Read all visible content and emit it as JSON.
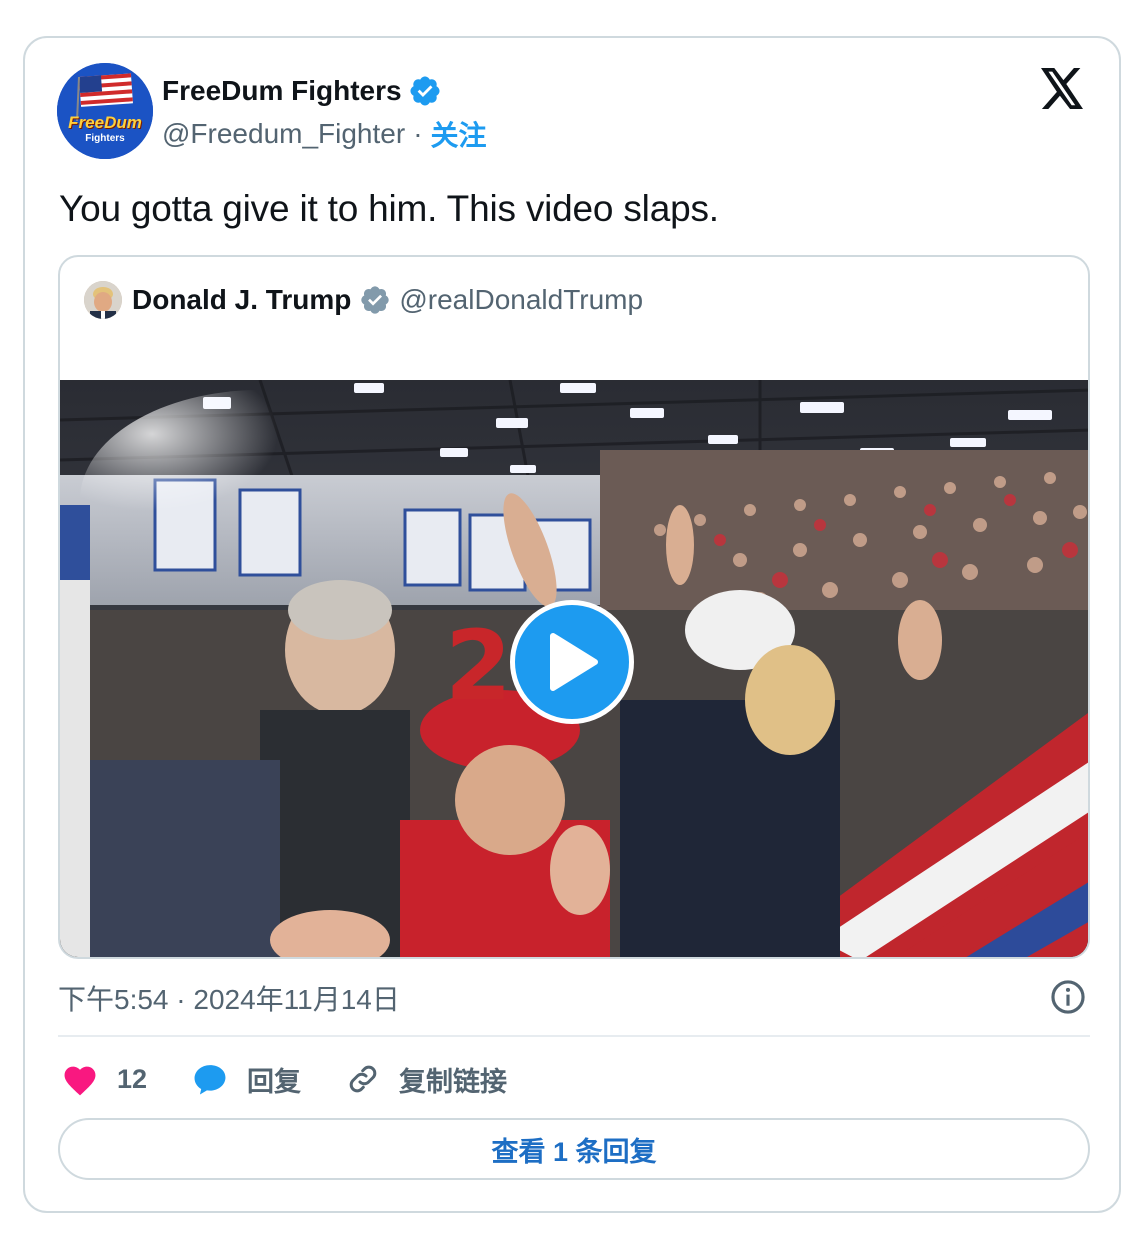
{
  "author": {
    "name": "FreeDum Fighters",
    "handle": "@Freedum_Fighter",
    "separator": "·",
    "follow_label": "关注",
    "avatar_text_1": "FreeDum",
    "avatar_text_2": "Fighters"
  },
  "tweet": {
    "text": "You gotta give it to him. This video slaps."
  },
  "quoted": {
    "name": "Donald J. Trump",
    "handle": "@realDonaldTrump",
    "video_overlay_text": "2  2"
  },
  "meta": {
    "timestamp": "下午5:54 · 2024年11月14日"
  },
  "actions": {
    "like_count": "12",
    "reply_label": "回复",
    "copy_link_label": "复制链接"
  },
  "replies_button": {
    "label": "查看 1 条回复"
  },
  "colors": {
    "verified": "#1d9bf0",
    "quote_verified": "#829aab",
    "like": "#f91880",
    "link": "#1d9bf0"
  }
}
